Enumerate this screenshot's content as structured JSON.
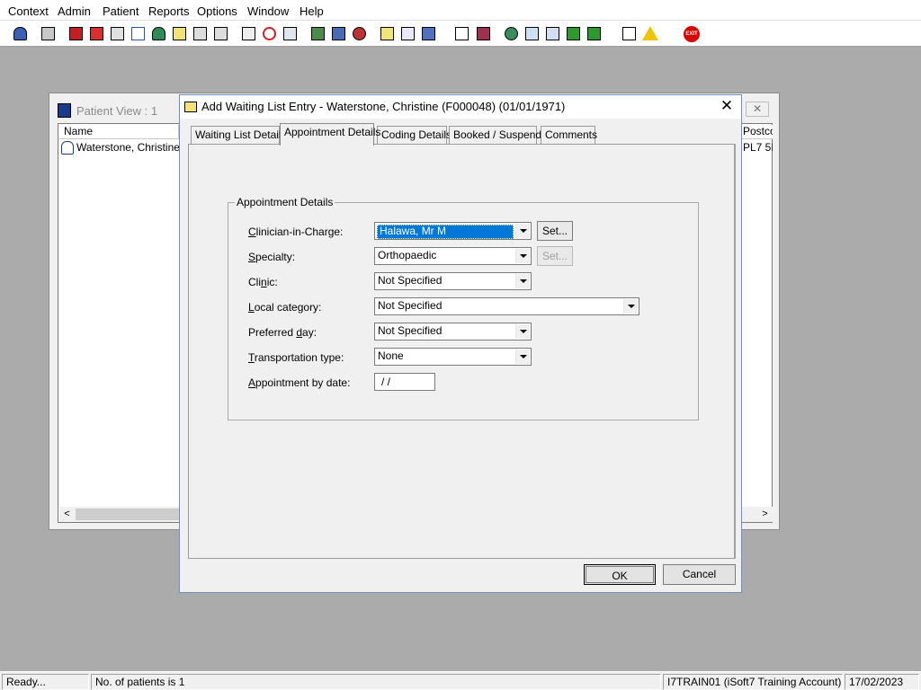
{
  "menu": [
    "Context",
    "Admin",
    "Patient",
    "Reports",
    "Options",
    "Window",
    "Help"
  ],
  "toolbar": {
    "icons": [
      "patient-icon",
      "printer-icon",
      "books-icon",
      "edit-patient-icon",
      "note-icon",
      "mail-merge-icon",
      "doctor-icon",
      "notebook-icon",
      "referral-icon",
      "letter-icon",
      "search-icon",
      "clock-icon",
      "screen-icon",
      "list-icon",
      "card-icon",
      "report-icon",
      "chart-icon",
      "page-icon",
      "bar-chart-icon",
      "globe-icon",
      "check-list-icon",
      "check-flag-icon",
      "download-icon",
      "upload-icon",
      "transfer-icon",
      "warning-icon",
      "exit-icon"
    ],
    "exit_label": "EXIT"
  },
  "patient_view": {
    "title": "Patient View : 1",
    "columns": {
      "name": "Name",
      "postcode": "Postco"
    },
    "rows": [
      {
        "name": "Waterstone, Christine...",
        "postcode": "PL7 5L"
      }
    ]
  },
  "dialog": {
    "title": "Add Waiting List Entry - Waterstone, Christine (F000048) (01/01/1971)",
    "close_glyph": "✕",
    "tabs": [
      "Waiting List Details",
      "Appointment Details",
      "Coding Details",
      "Booked / Suspend",
      "Comments"
    ],
    "active_tab": "Appointment Details",
    "group_label": "Appointment Details",
    "fields": {
      "clinician": {
        "pre": "",
        "acc": "C",
        "post": "linician-in-Charge:",
        "value": "Halawa, Mr M"
      },
      "specialty": {
        "pre": "",
        "acc": "S",
        "post": "pecialty:",
        "value": "Orthopaedic"
      },
      "clinic": {
        "pre": "Cli",
        "acc": "n",
        "post": "ic:",
        "value": "Not Specified"
      },
      "local_category": {
        "pre": "",
        "acc": "L",
        "post": "ocal category:",
        "value": "Not Specified"
      },
      "preferred_day": {
        "pre": "Preferred ",
        "acc": "d",
        "post": "ay:",
        "value": "Not Specified"
      },
      "transport": {
        "pre": "",
        "acc": "T",
        "post": "ransportation type:",
        "value": "None"
      },
      "appt_by_date": {
        "pre": "",
        "acc": "A",
        "post": "ppointment by date:",
        "value": "/  /"
      }
    },
    "set_label": "Set...",
    "ok_label": "OK",
    "cancel_label": "Cancel"
  },
  "status": {
    "ready": "Ready...",
    "patients": "No. of patients is 1",
    "account": "I7TRAIN01 (iSoft7 Training Account)",
    "date": "17/02/2023"
  }
}
